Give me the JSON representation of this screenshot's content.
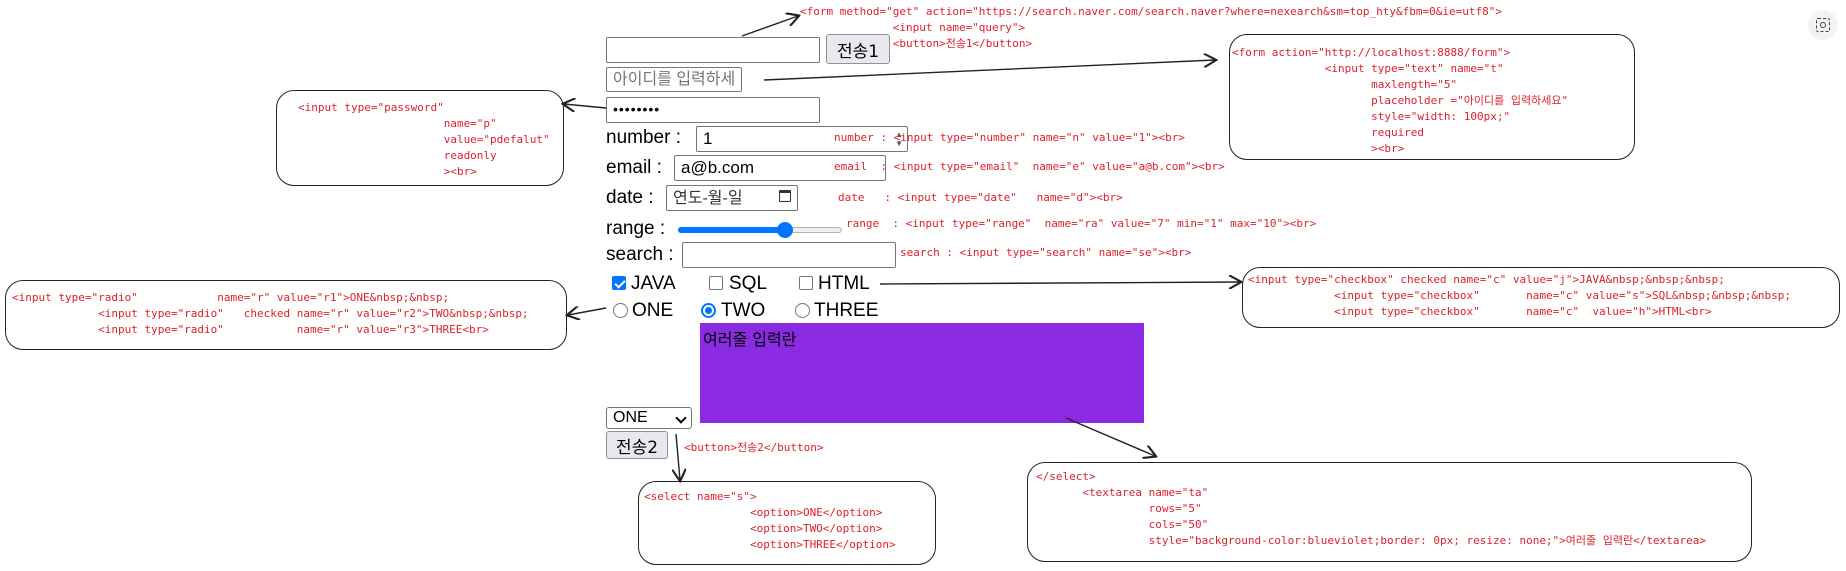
{
  "form1": {
    "query_value": "",
    "submit_label": "전송1",
    "annotation": "<form method=\"get\" action=\"https://search.naver.com/search.naver?where=nexearch&sm=top_hty&fbm=0&ie=utf8\">\n              <input name=\"query\">\n              <button>전송1</button>"
  },
  "form2": {
    "id_placeholder": "아이디를 입력하세요",
    "password_value": "pdefalut",
    "annotation_text_input": "<form action=\"http://localhost:8888/form\">\n              <input type=\"text\" name=\"t\"\n                     maxlength=\"5\"\n                     placeholder =\"아이디를 입력하세요\"\n                     style=\"width: 100px;\"\n                     required\n                     ><br>",
    "annotation_password": "<input type=\"password\"\n                      name=\"p\"\n                      value=\"pdefalut\"\n                      readonly\n                      ><br>"
  },
  "fields": {
    "number_label": "number :",
    "number_value": "1",
    "number_annotation": "number : <input type=\"number\" name=\"n\" value=\"1\"><br>",
    "email_label": "email :",
    "email_value": "a@b.com",
    "email_annotation": "email  : <input type=\"email\"  name=\"e\" value=\"a@b.com\"><br>",
    "date_label": "date :",
    "date_placeholder": "연도-월-일",
    "date_annotation": "date   : <input type=\"date\"   name=\"d\"><br>",
    "range_label": "range :",
    "range_value": 7,
    "range_min": 1,
    "range_max": 10,
    "range_annotation": "range  : <input type=\"range\"  name=\"ra\" value=\"7\" min=\"1\" max=\"10\"><br>",
    "search_label": "search :",
    "search_value": "",
    "search_annotation": "search : <input type=\"search\" name=\"se\"><br>"
  },
  "checkboxes": {
    "items": [
      {
        "label": "JAVA",
        "checked": true
      },
      {
        "label": "SQL",
        "checked": false
      },
      {
        "label": "HTML",
        "checked": false
      }
    ],
    "annotation": "<input type=\"checkbox\" checked name=\"c\" value=\"j\">JAVA&nbsp;&nbsp;&nbsp;\n             <input type=\"checkbox\"       name=\"c\" value=\"s\">SQL&nbsp;&nbsp;&nbsp;\n             <input type=\"checkbox\"       name=\"c\"  value=\"h\">HTML<br>"
  },
  "radios": {
    "items": [
      {
        "label": "ONE",
        "checked": false
      },
      {
        "label": "TWO",
        "checked": true
      },
      {
        "label": "THREE",
        "checked": false
      }
    ],
    "annotation": "<input type=\"radio\"            name=\"r\" value=\"r1\">ONE&nbsp;&nbsp;\n             <input type=\"radio\"   checked name=\"r\" value=\"r2\">TWO&nbsp;&nbsp;\n             <input type=\"radio\"           name=\"r\" value=\"r3\">THREE<br>"
  },
  "textarea": {
    "value": "여러줄 입력란",
    "background": "#8a2be2",
    "annotation": "</select>\n       <textarea name=\"ta\"\n                 rows=\"5\"\n                 cols=\"50\"\n                 style=\"background-color:blueviolet;border: 0px; resize: none;\">여러줄 입력란</textarea>"
  },
  "select": {
    "selected": "ONE",
    "annotation": "<select name=\"s\">\n                <option>ONE</option>\n                <option>TWO</option>\n                <option>THREE</option>"
  },
  "submit2": {
    "label": "전송2",
    "annotation": "<button>전송2</button>"
  },
  "colors": {
    "annotation": "#e0202a",
    "accent": "#0075ff",
    "textarea_bg": "#8a2be2"
  },
  "icons": {
    "screenshot_tool": "screen-capture-icon"
  }
}
